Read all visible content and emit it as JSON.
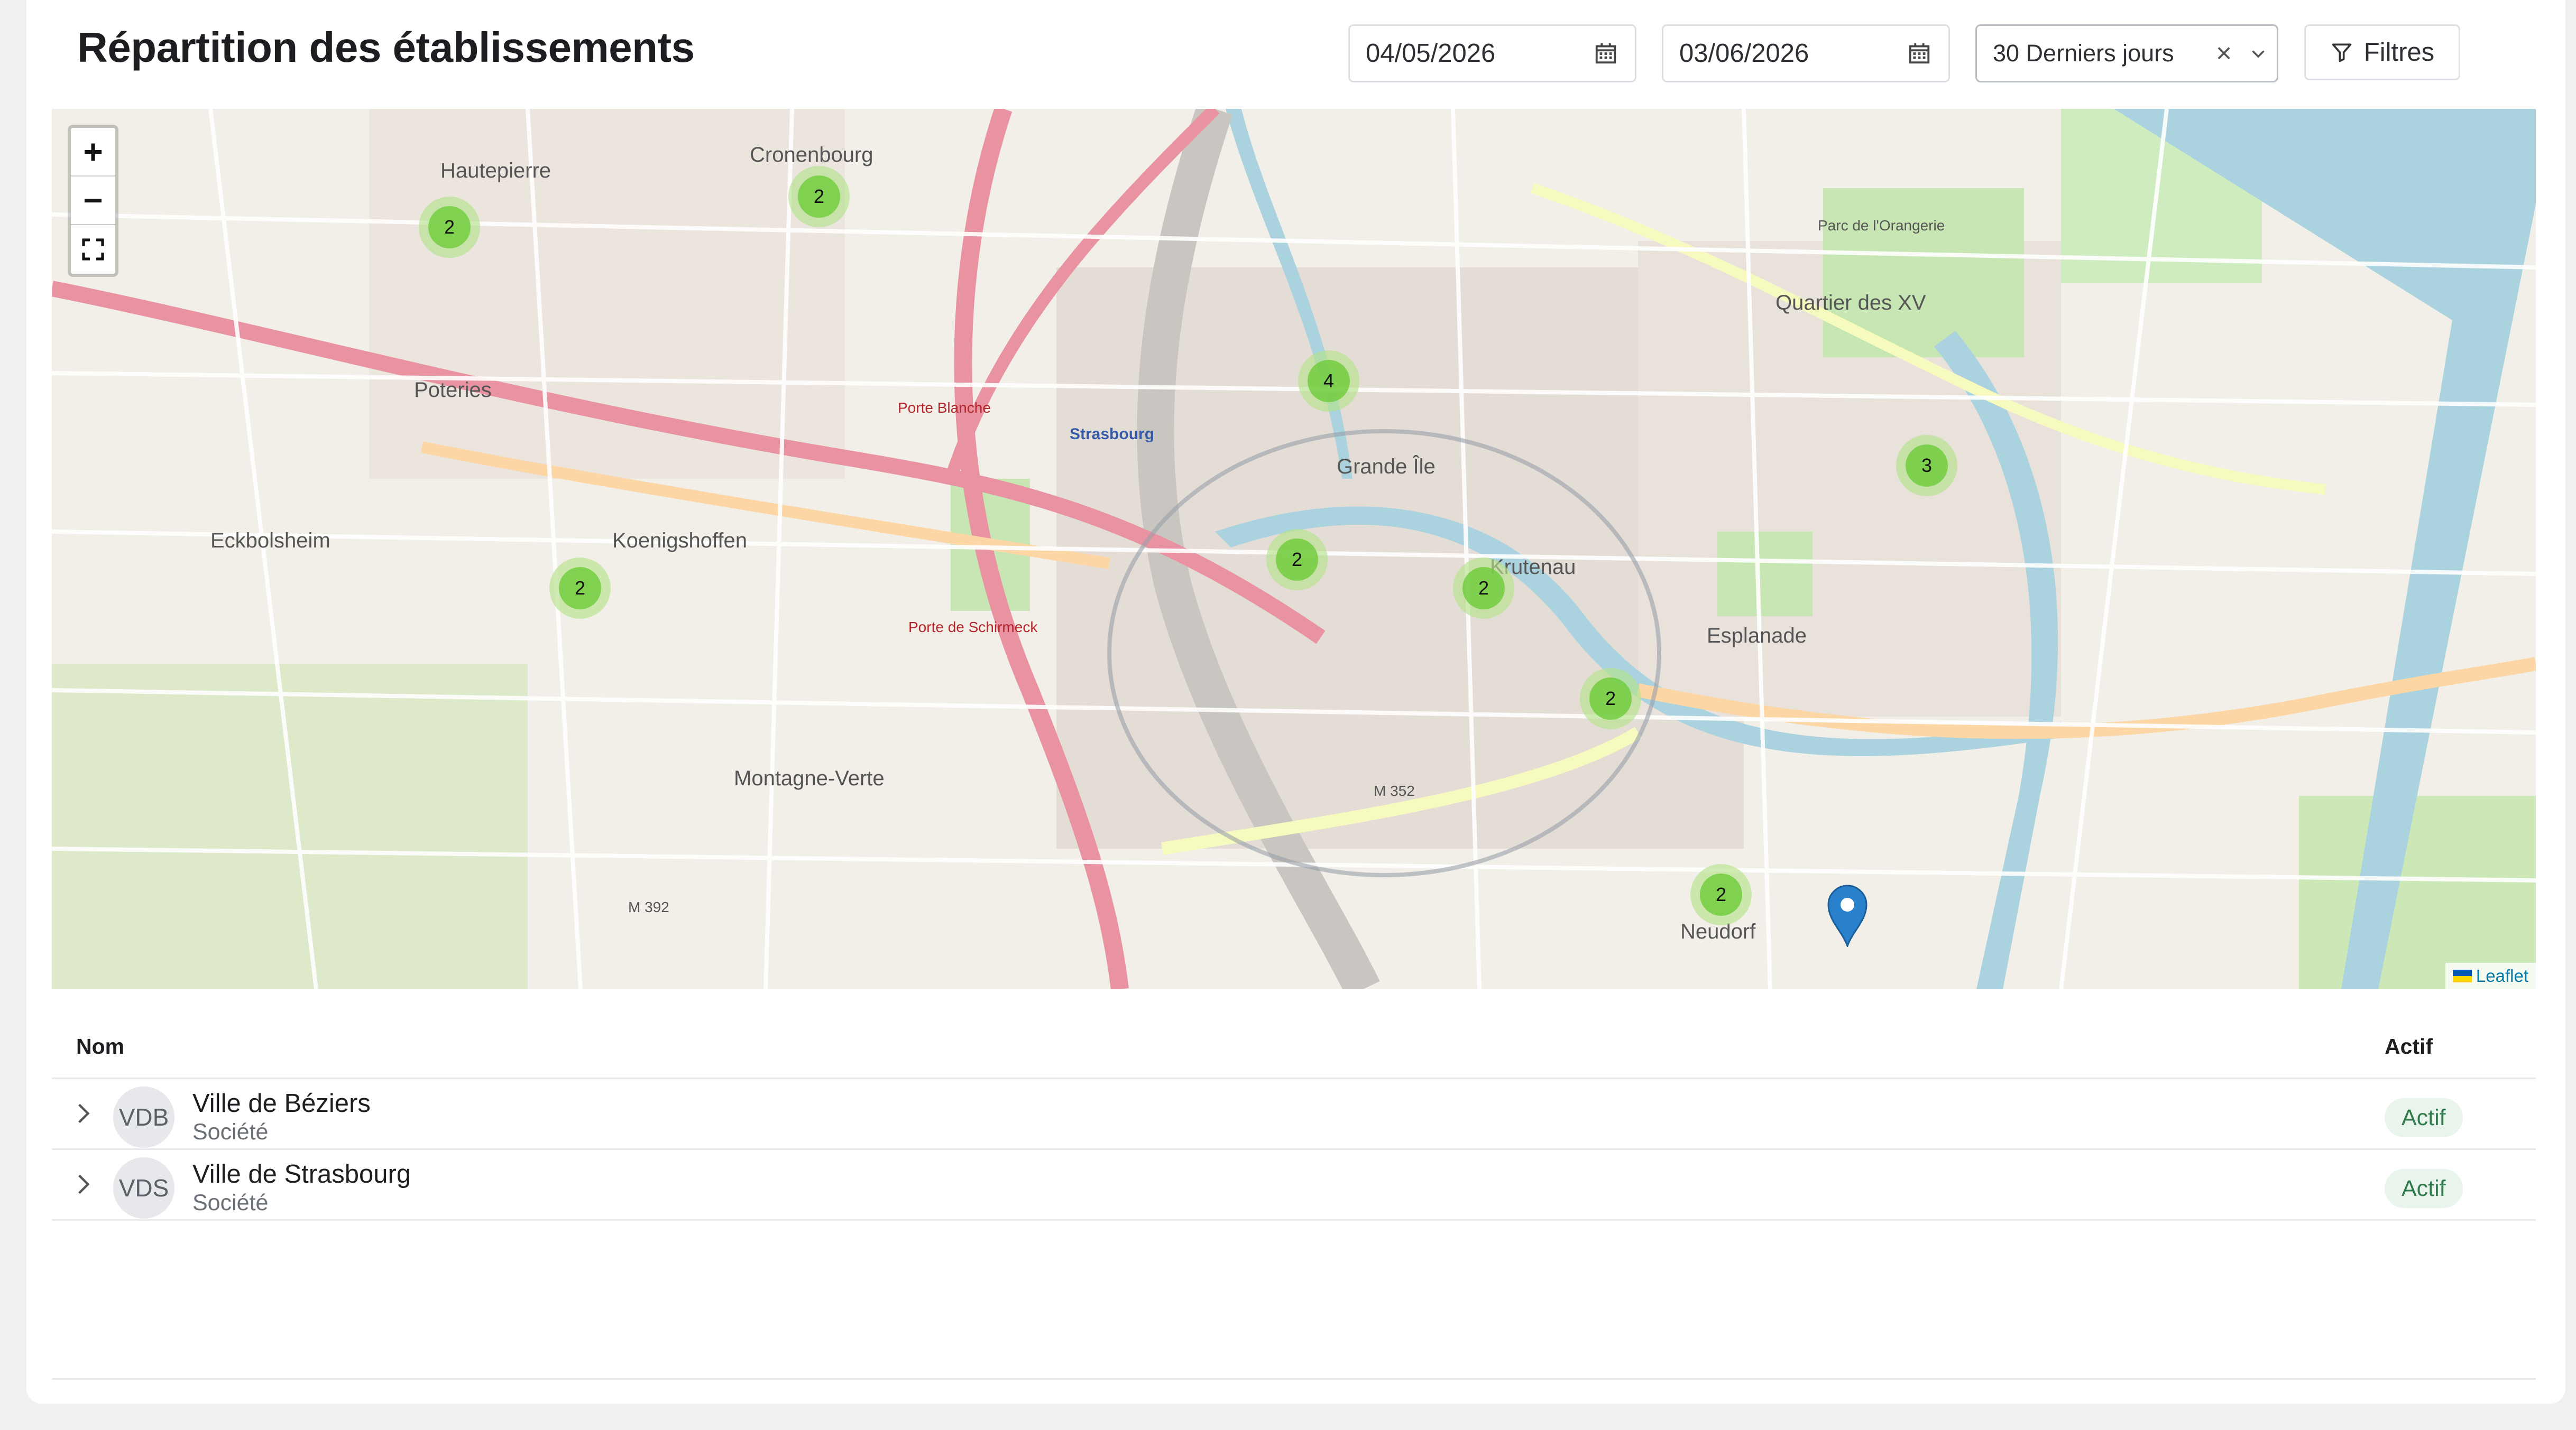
{
  "page": {
    "title": "Répartition des établissements"
  },
  "toolbar": {
    "date_from": "04/05/2026",
    "date_to": "03/06/2026",
    "period": "30 Derniers jours",
    "period_clear": "×",
    "filters_label": "Filtres"
  },
  "map": {
    "zoom_in": "+",
    "zoom_out": "−",
    "attribution": "Leaflet",
    "labels": [
      "Cronenbourg",
      "Hautepierre",
      "Poteries",
      "Koenigshoffen",
      "Eckbolsheim",
      "Montagne-Verte",
      "Strasbourg",
      "Grande Île",
      "Krutenau",
      "Esplanade",
      "Neudorf",
      "Quartier des XV",
      "Porte Blanche",
      "Porte de Schirmeck",
      "Parc de l'Orangerie",
      "M 352",
      "M 392"
    ],
    "clusters": [
      {
        "count": "2"
      },
      {
        "count": "2"
      },
      {
        "count": "4"
      },
      {
        "count": "3"
      },
      {
        "count": "2"
      },
      {
        "count": "2"
      },
      {
        "count": "2"
      },
      {
        "count": "2"
      },
      {
        "count": "2"
      }
    ],
    "colors": {
      "cluster_outer": "#b5e28c",
      "cluster_inner": "#6ecc39",
      "pin": "#2a81cb"
    }
  },
  "table": {
    "col_name": "Nom",
    "col_active": "Actif",
    "rows": [
      {
        "initials": "VDB",
        "name": "Ville de Béziers",
        "type": "Société",
        "status": "Actif"
      },
      {
        "initials": "VDS",
        "name": "Ville de Strasbourg",
        "type": "Société",
        "status": "Actif"
      }
    ]
  }
}
